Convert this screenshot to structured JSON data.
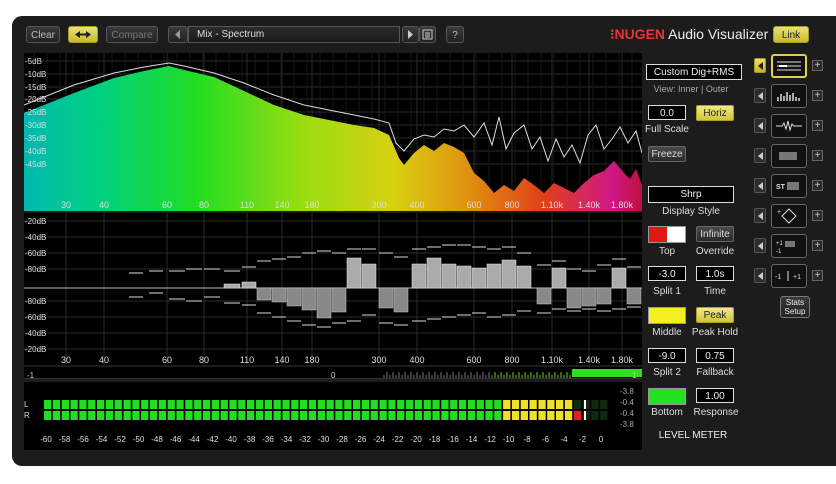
{
  "toolbar": {
    "clear": "Clear",
    "compare": "Compare",
    "preset": "Mix - Spectrum",
    "help": "?",
    "link": "Link"
  },
  "title": {
    "brand": "NUGEN",
    "product": "Audio Visualizer"
  },
  "spectrum": {
    "db_labels": [
      "-5dB",
      "-10dB",
      "-15dB",
      "-20dB",
      "-25dB",
      "-30dB",
      "-35dB",
      "-40dB",
      "-45dB"
    ],
    "freq_labels": [
      "30",
      "40",
      "60",
      "80",
      "110",
      "140",
      "180",
      "300",
      "400",
      "600",
      "800",
      "1.10k",
      "1.40k",
      "1.80k"
    ]
  },
  "stereo": {
    "top_labels": [
      "-20dB",
      "-40dB",
      "-60dB",
      "-80dB"
    ],
    "bottom_labels": [
      "-80dB",
      "-60dB",
      "-40dB",
      "-20dB"
    ],
    "freq_labels": [
      "30",
      "40",
      "60",
      "80",
      "110",
      "140",
      "180",
      "300",
      "400",
      "600",
      "800",
      "1.10k",
      "1.40k",
      "1.80k"
    ]
  },
  "correlation": {
    "left": "-1",
    "center": "0",
    "right": "1"
  },
  "meter": {
    "l": "L",
    "r": "R",
    "values": [
      "-3.8",
      "-0.4",
      "-0.4",
      "-3.8"
    ],
    "scale": [
      "-60",
      "-58",
      "-56",
      "-54",
      "-52",
      "-50",
      "-48",
      "-46",
      "-44",
      "-42",
      "-40",
      "-38",
      "-36",
      "-34",
      "-32",
      "-30",
      "-28",
      "-26",
      "-24",
      "-22",
      "-20",
      "-18",
      "-16",
      "-14",
      "-12",
      "-10",
      "-8",
      "-6",
      "-4",
      "-2",
      "0"
    ],
    "l_level": 0.93,
    "r_level": 0.95,
    "title": "LEVEL METER"
  },
  "controls": {
    "mode": "Custom Dig+RMS",
    "view": "View: Inner | Outer",
    "scale_value": "0.0",
    "horiz": "Horiz",
    "full_scale": "Full Scale",
    "freeze": "Freeze",
    "display_style_value": "Shrp",
    "display_style": "Display Style",
    "infinite": "Infinite",
    "top": "Top",
    "override": "Override",
    "split1_value": "-3.0",
    "time_value": "1.0s",
    "split1": "Split 1",
    "time": "Time",
    "peak": "Peak",
    "middle": "Middle",
    "peak_hold": "Peak Hold",
    "split2_value": "-9.0",
    "fallback_value": "0.75",
    "split2": "Split 2",
    "fallback": "Fallback",
    "response_value": "1.00",
    "bottom": "Bottom",
    "response": "Response",
    "colors": {
      "top": "#e01818",
      "middle": "#f4f020",
      "bottom": "#22e022"
    }
  },
  "views": {
    "stats_setup": "Stats Setup",
    "icons": [
      "lines-view-icon",
      "spectrum-view-icon",
      "waveform-view-icon",
      "meter-view-icon",
      "stereo-view-icon",
      "diamond-view-icon",
      "correlation-view-icon",
      "balance-view-icon"
    ]
  }
}
